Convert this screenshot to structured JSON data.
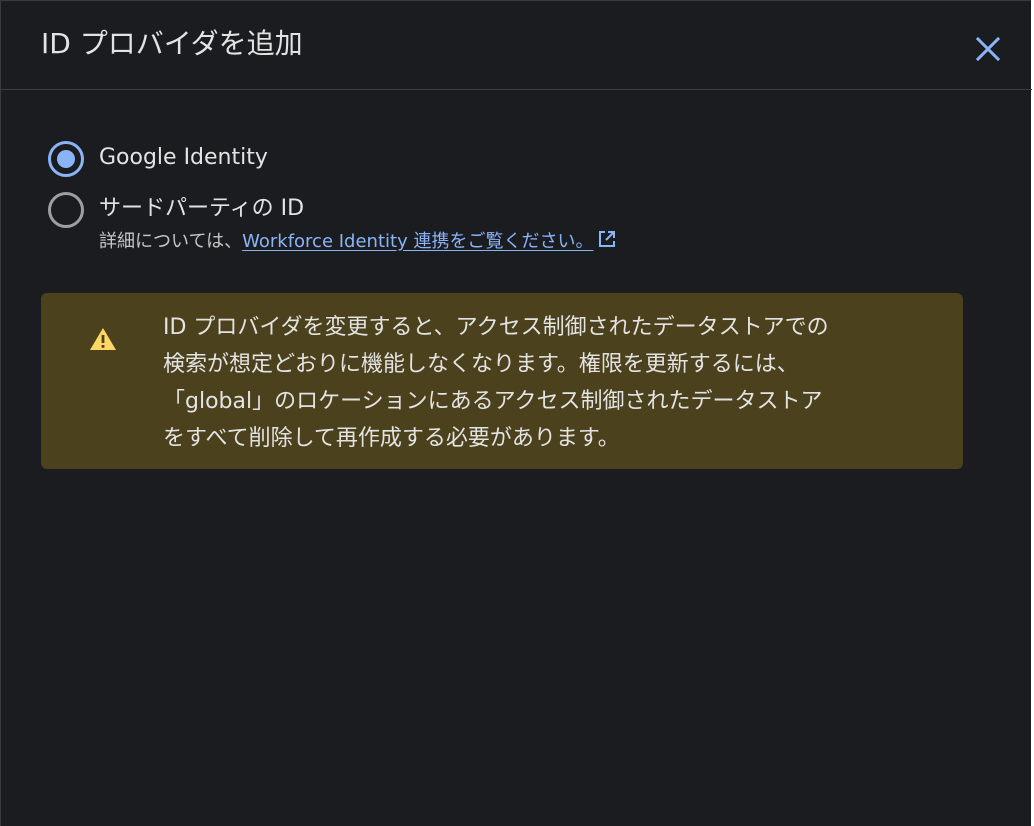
{
  "dialog": {
    "title": "ID プロバイダを追加",
    "close_icon": "close-icon",
    "accent_color": "#8ab4f8",
    "background_color": "#1b1c1f"
  },
  "options": [
    {
      "label": "Google Identity",
      "selected": true
    },
    {
      "label": "サードパーティの ID",
      "selected": false
    }
  ],
  "helper": {
    "prefix": "詳細については、",
    "link_text": "Workforce Identity 連携をご覧ください。",
    "link_icon": "open-in-new-icon"
  },
  "warning": {
    "icon": "warning-icon",
    "background_color": "#4b411c",
    "lines": [
      "ID プロバイダを変更すると、アクセス制御されたデータストアでの",
      "検索が想定どおりに機能しなくなります。権限を更新するには、",
      "「global」のロケーションにあるアクセス制御されたデータストア",
      "をすべて削除して再作成する必要があります。"
    ]
  }
}
